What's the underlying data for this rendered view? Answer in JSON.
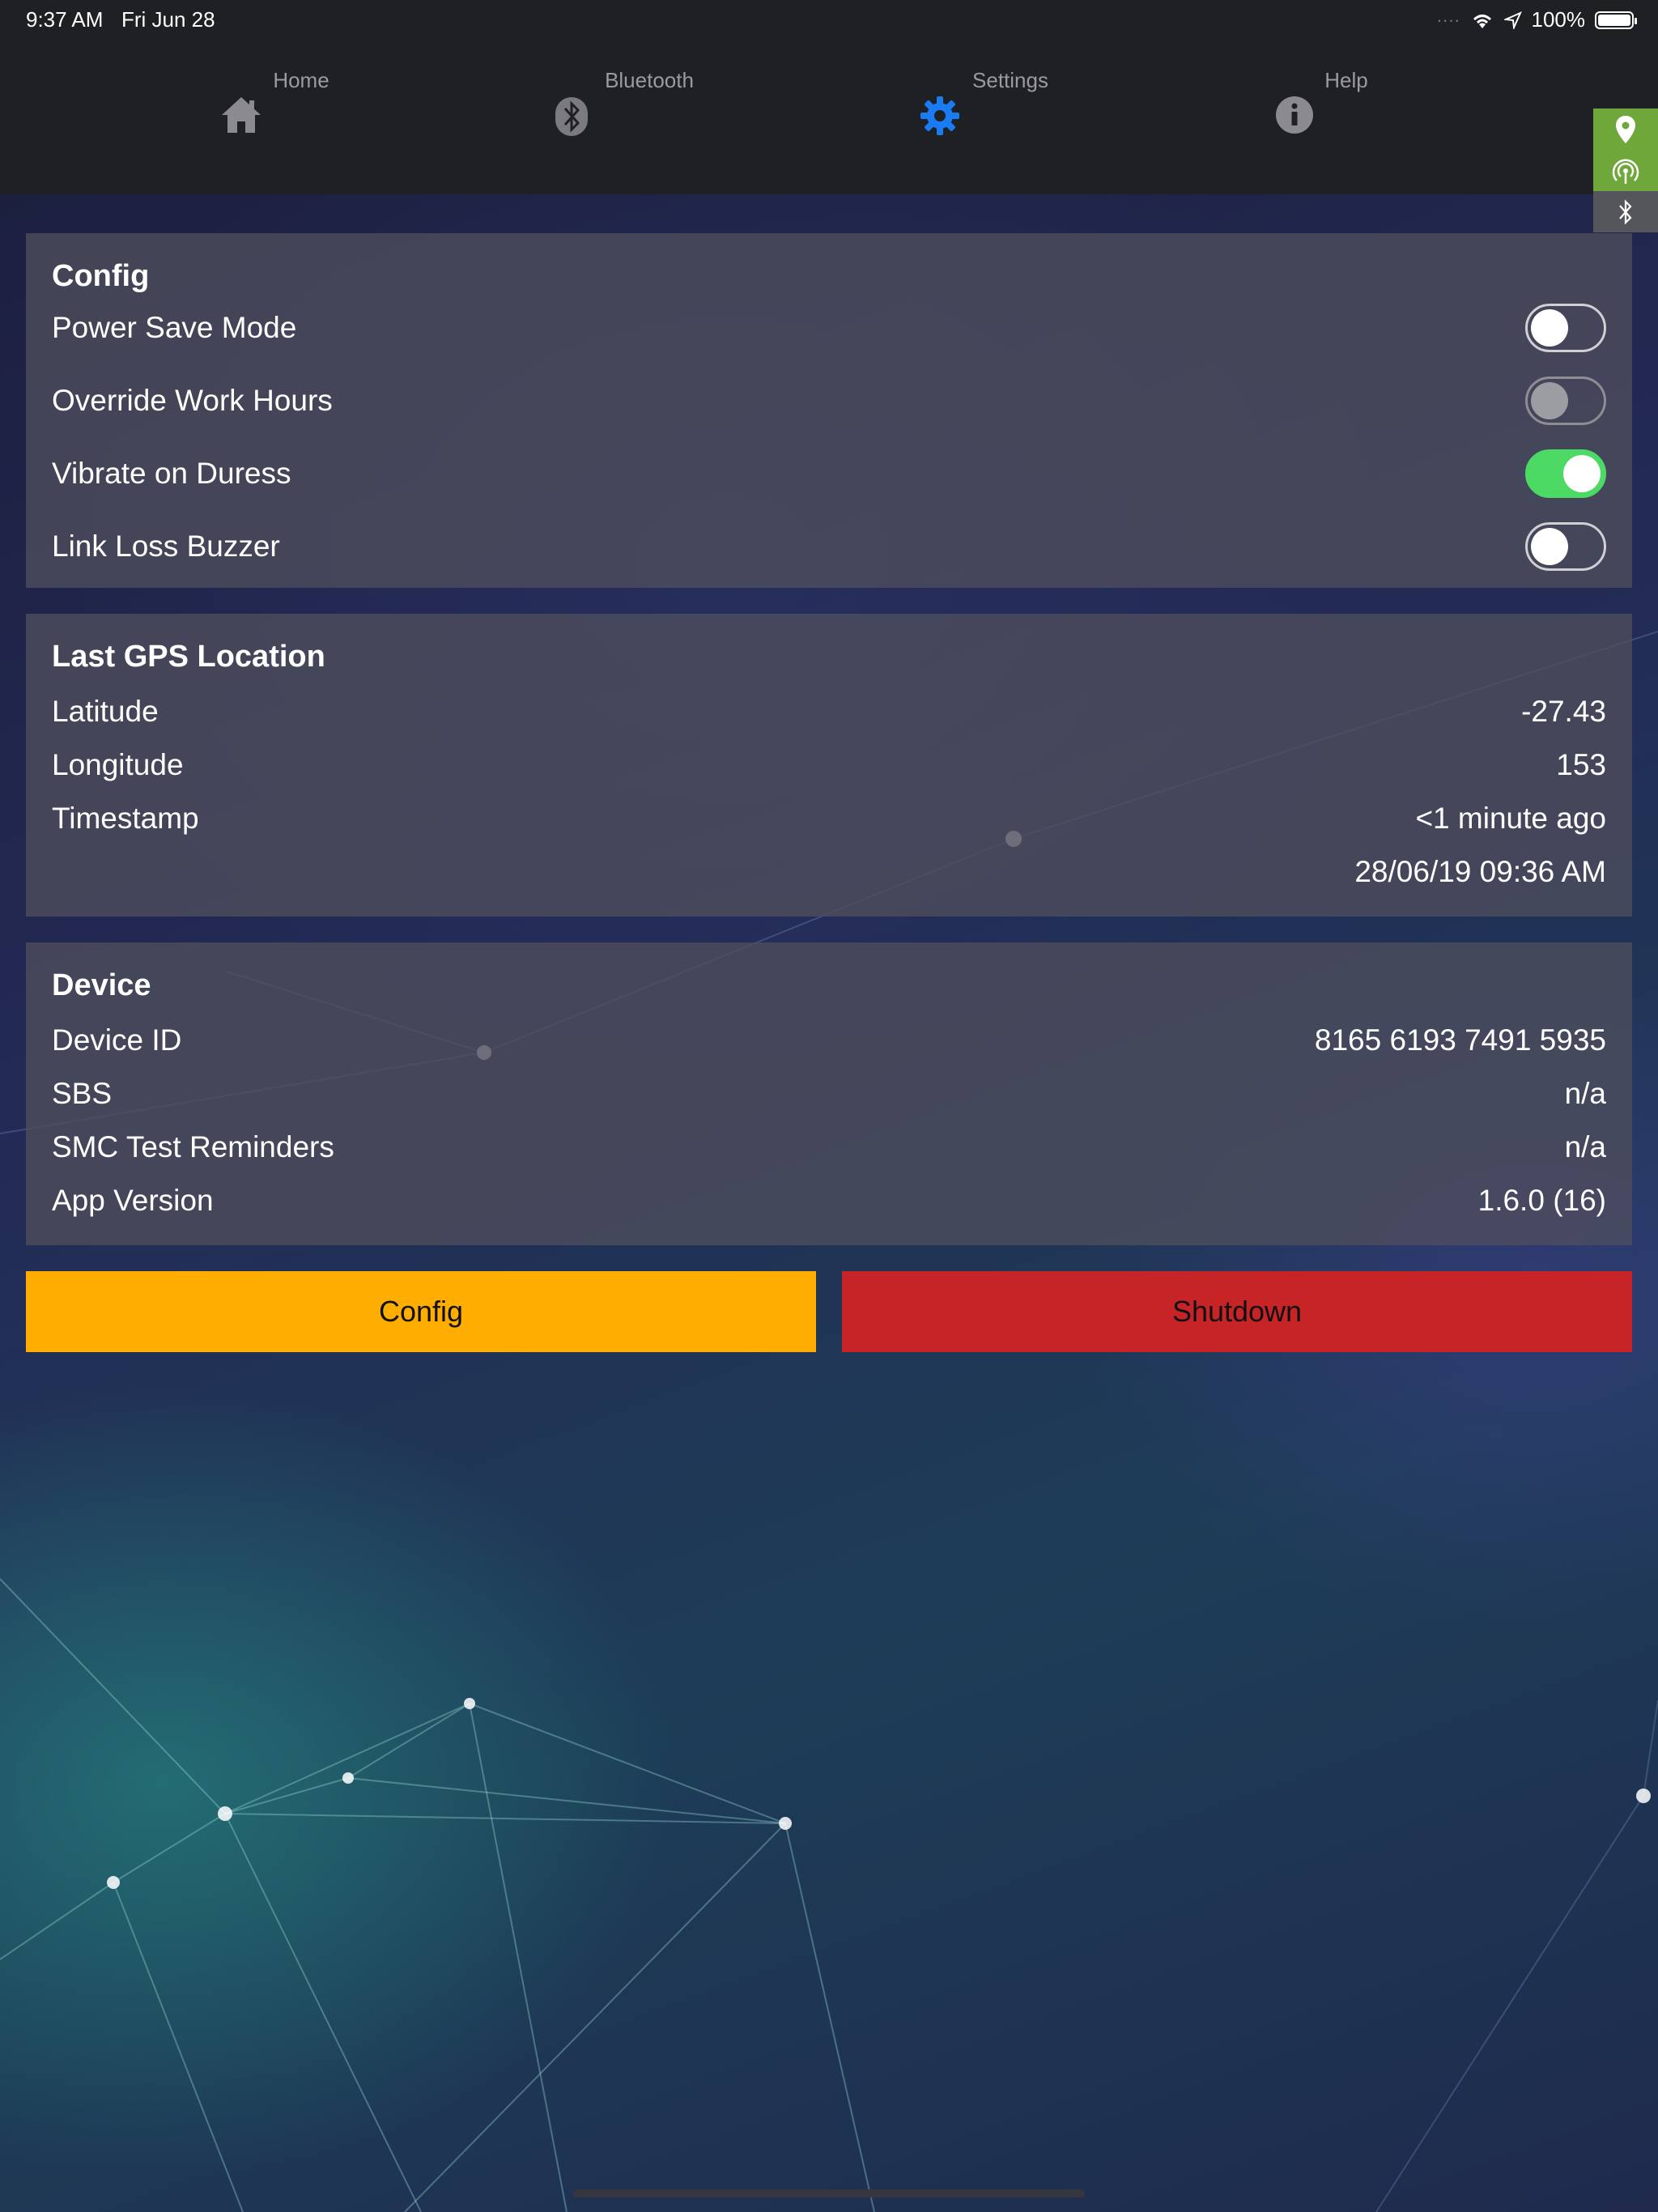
{
  "statusbar": {
    "time": "9:37 AM",
    "date": "Fri Jun 28",
    "battery": "100%",
    "battery_level": 1.0
  },
  "nav": {
    "tabs": [
      {
        "label": "Home",
        "icon": "home-icon"
      },
      {
        "label": "Bluetooth",
        "icon": "bluetooth-icon"
      },
      {
        "label": "Settings",
        "icon": "gear-icon",
        "active": true
      },
      {
        "label": "Help",
        "icon": "info-icon"
      }
    ],
    "side_status": [
      "location-icon",
      "signal-icon",
      "bluetooth-icon"
    ]
  },
  "config_panel": {
    "title": "Config",
    "items": [
      {
        "label": "Power Save Mode",
        "state": "off"
      },
      {
        "label": "Override Work Hours",
        "state": "disabled"
      },
      {
        "label": "Vibrate on Duress",
        "state": "on"
      },
      {
        "label": "Link Loss Buzzer",
        "state": "off"
      }
    ]
  },
  "gps_panel": {
    "title": "Last GPS Location",
    "latitude_label": "Latitude",
    "latitude": "-27.43",
    "longitude_label": "Longitude",
    "longitude": "153",
    "timestamp_label": "Timestamp",
    "timestamp_relative": "<1 minute ago",
    "timestamp_absolute": "28/06/19 09:36 AM"
  },
  "device_panel": {
    "title": "Device",
    "rows": [
      {
        "label": "Device ID",
        "value": "8165 6193 7491 5935"
      },
      {
        "label": "SBS",
        "value": "n/a"
      },
      {
        "label": "SMC Test Reminders",
        "value": "n/a"
      },
      {
        "label": "App Version",
        "value": "1.6.0 (16)"
      }
    ]
  },
  "buttons": {
    "config": "Config",
    "shutdown": "Shutdown"
  },
  "colors": {
    "accent": "#1a7bf2",
    "toggle_on": "#4cd964",
    "config_button": "#ffad00",
    "shutdown_button": "#c62427",
    "side_status_active": "#6fa73a",
    "side_status_inactive": "#55565c"
  }
}
